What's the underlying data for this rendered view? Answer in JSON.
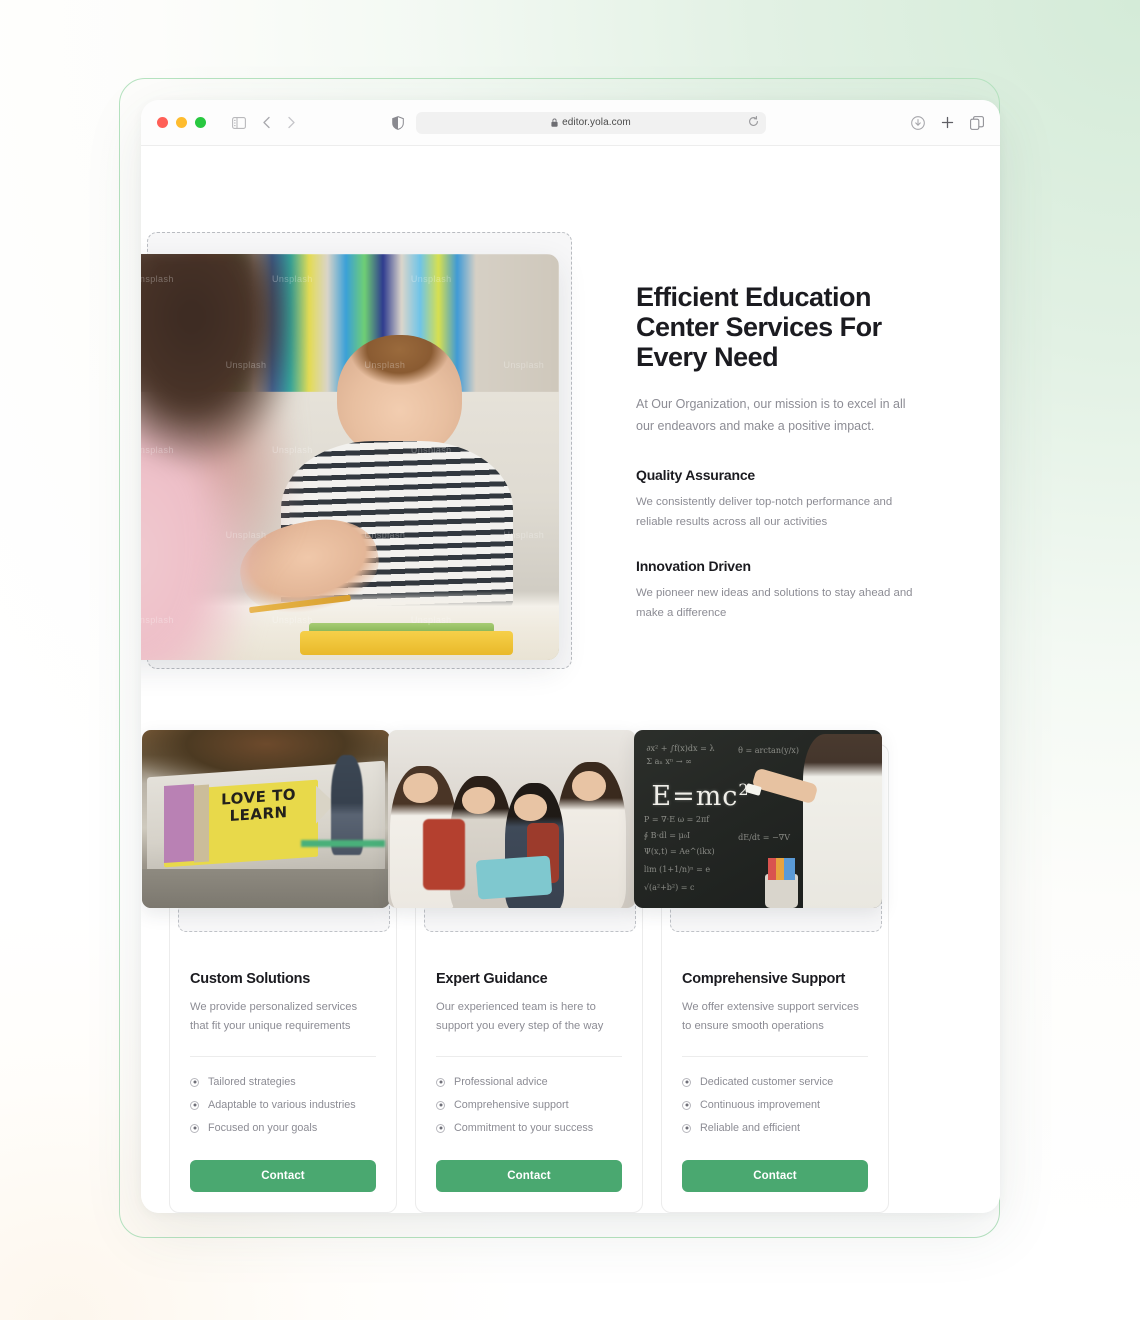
{
  "browser": {
    "url": "editor.yola.com",
    "traffic_lights": [
      "close-red",
      "minimize-yellow",
      "maximize-green"
    ],
    "icons": {
      "sidebar": "sidebar-toggle-icon",
      "back": "back-chevron-icon",
      "forward": "forward-chevron-icon",
      "shield": "privacy-shield-icon",
      "lock": "lock-icon",
      "reload": "reload-icon",
      "download": "download-icon",
      "new_tab": "plus-icon",
      "tab_overview": "tab-overview-icon"
    }
  },
  "hero": {
    "title": "Efficient Education Center Services For Every Need",
    "subtitle": "At Our Organization, our mission is to excel in all our endeavors and make a positive impact.",
    "features": [
      {
        "title": "Quality Assurance",
        "text": "We consistently deliver top-notch performance and reliable results across all our activities"
      },
      {
        "title": "Innovation Driven",
        "text": "We pioneer new ideas and solutions to stay ahead and make a difference"
      }
    ],
    "image_alt": "boy-at-desk-photo"
  },
  "cards": [
    {
      "title": "Custom Solutions",
      "desc": "We provide personalized services that fit your unique requirements",
      "bullets": [
        "Tailored strategies",
        "Adaptable to various industries",
        "Focused on your goals"
      ],
      "button": "Contact",
      "image_alt": "love-to-learn-sign-photo",
      "image_text_line1": "LOVE TO",
      "image_text_line2": "LEARN"
    },
    {
      "title": "Expert Guidance",
      "desc": "Our experienced team is here to support you every step of the way",
      "bullets": [
        "Professional advice",
        "Comprehensive support",
        "Commitment to your success"
      ],
      "button": "Contact",
      "image_alt": "students-with-tablet-photo"
    },
    {
      "title": "Comprehensive Support",
      "desc": "We offer extensive support services to ensure smooth operations",
      "bullets": [
        "Dedicated customer service",
        "Continuous improvement",
        "Reliable and efficient"
      ],
      "button": "Contact",
      "image_alt": "chalkboard-emc2-photo",
      "image_equation": "E=mc",
      "image_equation_sup": "2"
    }
  ],
  "colors": {
    "accent_green": "#4aa870",
    "frame_green": "#b6e3c0",
    "heading": "#1b1b20",
    "body_text": "#8c8c94",
    "dashed_border": "#bfc2c7"
  }
}
